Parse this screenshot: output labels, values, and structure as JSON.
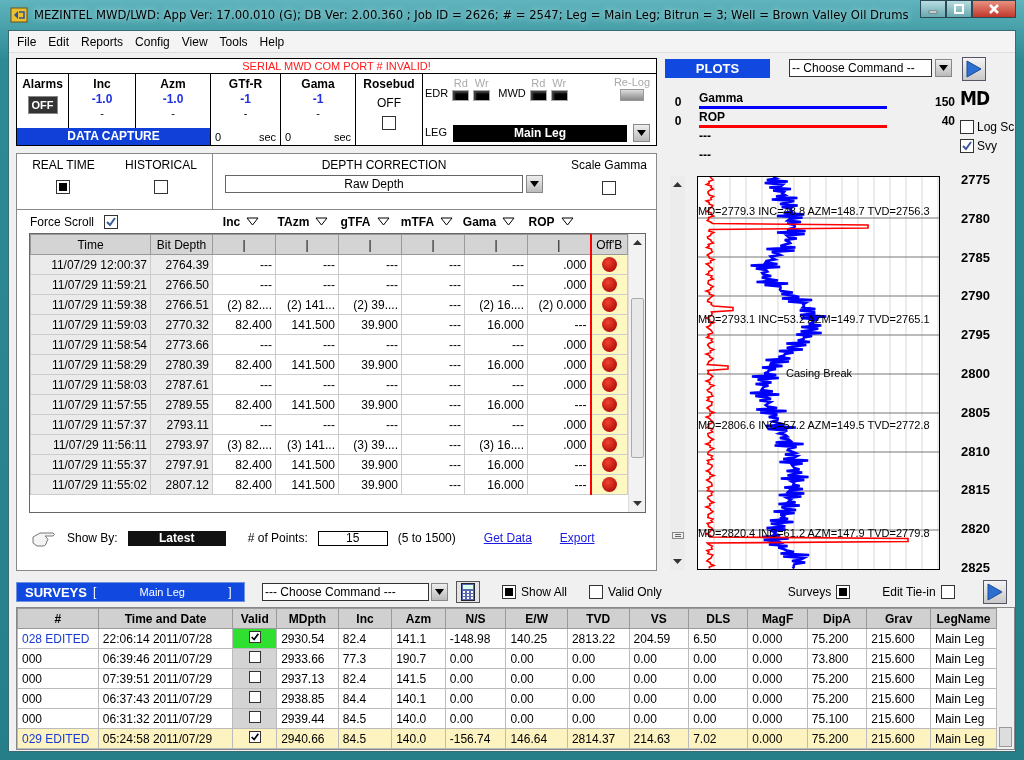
{
  "window": {
    "title": "MEZINTEL MWD/LWD: App Ver: 17.00.010 (G); DB Ver: 2.00.360 ; Job ID = 2626; # = 2547; Leg = Main Leg; Bitrun = 3; Well = Brown Valley Oil Drums"
  },
  "menu": [
    "File",
    "Edit",
    "Reports",
    "Config",
    "View",
    "Tools",
    "Help"
  ],
  "data_capture": {
    "warning": "SERIAL MWD COM PORT # INVALID!",
    "title": "DATA CAPTURE",
    "alarms": {
      "label": "Alarms",
      "button": "OFF"
    },
    "readouts": [
      {
        "label": "Inc",
        "value": "-1.0",
        "sub": "-"
      },
      {
        "label": "Azm",
        "value": "-1.0",
        "sub": "-"
      },
      {
        "label": "GTf-R",
        "value": "-1",
        "sub": "-",
        "time": "0",
        "unit": "sec"
      },
      {
        "label": "Gama",
        "value": "-1",
        "sub": "-",
        "time": "0",
        "unit": "sec"
      }
    ],
    "rosebud": {
      "label": "Rosebud",
      "value": "OFF",
      "checked": false
    },
    "lights": [
      {
        "label": "EDR",
        "read": "Rd",
        "write": "Wr"
      },
      {
        "label": "MWD",
        "read": "Rd",
        "write": "Wr"
      }
    ],
    "relog": "Re-Log",
    "leg": {
      "label": "LEG",
      "value": "Main Leg"
    }
  },
  "mode": [
    {
      "label": "REAL TIME",
      "selected": true
    },
    {
      "label": "HISTORICAL",
      "selected": false
    }
  ],
  "depth_correction": {
    "label": "DEPTH CORRECTION",
    "value": "Raw Depth"
  },
  "scale_gamma": {
    "label": "Scale Gamma",
    "checked": false
  },
  "force_scroll": {
    "label": "Force Scroll",
    "checked": true
  },
  "column_selectors": [
    "Inc",
    "TAzm",
    "gTFA",
    "mTFA",
    "Gama",
    "ROP"
  ],
  "data_table": {
    "columns": [
      "Time",
      "Bit Depth",
      "|",
      "|",
      "|",
      "|",
      "|",
      "|",
      "Off'B"
    ],
    "rows": [
      {
        "cells": [
          "11/07/29 12:00:37",
          "2764.39",
          "---",
          "---",
          "---",
          "---",
          "---",
          ".000"
        ],
        "off_bottom": true
      },
      {
        "cells": [
          "11/07/29 11:59:21",
          "2766.50",
          "---",
          "---",
          "---",
          "---",
          "---",
          ".000"
        ],
        "off_bottom": true
      },
      {
        "cells": [
          "11/07/29 11:59:38",
          "2766.51",
          "(2) 82....",
          "(2) 141...",
          "(2) 39....",
          "---",
          "(2) 16....",
          "(2) 0.000"
        ],
        "off_bottom": true
      },
      {
        "cells": [
          "11/07/29 11:59:03",
          "2770.32",
          "82.400",
          "141.500",
          "39.900",
          "---",
          "16.000",
          "---"
        ],
        "off_bottom": true
      },
      {
        "cells": [
          "11/07/29 11:58:54",
          "2773.66",
          "---",
          "---",
          "---",
          "---",
          "---",
          ".000"
        ],
        "off_bottom": true
      },
      {
        "cells": [
          "11/07/29 11:58:29",
          "2780.39",
          "82.400",
          "141.500",
          "39.900",
          "---",
          "16.000",
          ".000"
        ],
        "off_bottom": true
      },
      {
        "cells": [
          "11/07/29 11:58:03",
          "2787.61",
          "---",
          "---",
          "---",
          "---",
          "---",
          ".000"
        ],
        "off_bottom": true
      },
      {
        "cells": [
          "11/07/29 11:57:55",
          "2789.55",
          "82.400",
          "141.500",
          "39.900",
          "---",
          "16.000",
          "---"
        ],
        "off_bottom": true
      },
      {
        "cells": [
          "11/07/29 11:57:37",
          "2793.11",
          "---",
          "---",
          "---",
          "---",
          "---",
          ".000"
        ],
        "off_bottom": true
      },
      {
        "cells": [
          "11/07/29 11:56:11",
          "2793.97",
          "(3) 82....",
          "(3) 141...",
          "(3) 39....",
          "---",
          "(3) 16....",
          ".000"
        ],
        "off_bottom": true
      },
      {
        "cells": [
          "11/07/29 11:55:37",
          "2797.91",
          "82.400",
          "141.500",
          "39.900",
          "---",
          "16.000",
          "---"
        ],
        "off_bottom": true
      },
      {
        "cells": [
          "11/07/29 11:55:02",
          "2807.12",
          "82.400",
          "141.500",
          "39.900",
          "---",
          "16.000",
          "---"
        ],
        "off_bottom": true
      }
    ]
  },
  "show_by": {
    "label": "Show By:",
    "value": "Latest"
  },
  "points": {
    "label": "# of Points:",
    "value": "15",
    "range": "(5 to 1500)"
  },
  "links": [
    "Get Data",
    "Export"
  ],
  "plots": {
    "title": "PLOTS",
    "command": "-- Choose Command --",
    "axis_label": "MD",
    "curves": [
      {
        "name": "Gamma",
        "min": "0",
        "max": "150",
        "color": "#0000ff"
      },
      {
        "name": "ROP",
        "min": "0",
        "max": "40",
        "color": "#ff0000"
      },
      {
        "name": "---"
      },
      {
        "name": "---"
      }
    ],
    "log_scale": {
      "label": "Log Sc",
      "checked": false
    },
    "survey": {
      "label": "Svy",
      "checked": true
    },
    "depth_labels": [
      "2775",
      "2780",
      "2785",
      "2790",
      "2795",
      "2800",
      "2805",
      "2810",
      "2815",
      "2820",
      "2825"
    ],
    "annotations": [
      "MD=2779.3 INC=48.8 AZM=148.7 TVD=2756.3",
      "MD=2793.1 INC=53.2 AZM=149.7 TVD=2765.1",
      "Casing Break",
      "MD=2806.6 INC=57.2 AZM=149.5 TVD=2772.8",
      "MD=2820.4 INC=61.2 AZM=147.9 TVD=2779.8"
    ]
  },
  "surveys": {
    "title": "SURVEYS",
    "leg_open": "[",
    "leg": "Main Leg",
    "leg_close": "]",
    "command": "--- Choose Command ---",
    "options": [
      {
        "label": "Show All",
        "checked": true,
        "kind": "after"
      },
      {
        "label": "Valid Only",
        "checked": false,
        "kind": "after"
      },
      {
        "label": "Surveys",
        "checked": true,
        "kind": "before"
      },
      {
        "label": "Edit Tie-in",
        "checked": false,
        "kind": "before"
      }
    ],
    "columns": [
      "#",
      "Time and Date",
      "Valid",
      "MDpth",
      "Inc",
      "Azm",
      "N/S",
      "E/W",
      "TVD",
      "VS",
      "DLS",
      "MagF",
      "DipA",
      "Grav",
      "LegName"
    ],
    "rows": [
      {
        "valid": true,
        "edited": true,
        "focused": true,
        "selected": false,
        "cells": [
          "028 EDITED",
          "22:06:14 2011/07/28",
          "",
          "2930.54",
          "82.4",
          "141.1",
          "-148.98",
          "140.25",
          "2813.22",
          "204.59",
          "6.50",
          "0.000",
          "75.200",
          "215.600",
          "Main Leg"
        ]
      },
      {
        "valid": false,
        "edited": false,
        "focused": false,
        "selected": false,
        "cells": [
          "000",
          "06:39:46 2011/07/29",
          "",
          "2933.66",
          "77.3",
          "190.7",
          "0.00",
          "0.00",
          "0.00",
          "0.00",
          "0.00",
          "0.000",
          "73.800",
          "215.600",
          "Main Leg"
        ]
      },
      {
        "valid": false,
        "edited": false,
        "focused": false,
        "selected": false,
        "cells": [
          "000",
          "07:39:51 2011/07/29",
          "",
          "2937.13",
          "82.4",
          "141.5",
          "0.00",
          "0.00",
          "0.00",
          "0.00",
          "0.00",
          "0.000",
          "75.200",
          "215.600",
          "Main Leg"
        ]
      },
      {
        "valid": false,
        "edited": false,
        "focused": false,
        "selected": false,
        "cells": [
          "000",
          "06:37:43 2011/07/29",
          "",
          "2938.85",
          "84.4",
          "140.1",
          "0.00",
          "0.00",
          "0.00",
          "0.00",
          "0.00",
          "0.000",
          "75.200",
          "215.600",
          "Main Leg"
        ]
      },
      {
        "valid": false,
        "edited": false,
        "focused": false,
        "selected": false,
        "cells": [
          "000",
          "06:31:32 2011/07/29",
          "",
          "2939.44",
          "84.5",
          "140.0",
          "0.00",
          "0.00",
          "0.00",
          "0.00",
          "0.00",
          "0.000",
          "75.100",
          "215.600",
          "Main Leg"
        ]
      },
      {
        "valid": true,
        "edited": true,
        "focused": false,
        "selected": true,
        "cells": [
          "029 EDITED",
          "05:24:58 2011/07/29",
          "",
          "2940.66",
          "84.5",
          "140.0",
          "-156.74",
          "146.64",
          "2814.37",
          "214.63",
          "7.02",
          "0.000",
          "75.200",
          "215.600",
          "Main Leg"
        ]
      }
    ]
  }
}
